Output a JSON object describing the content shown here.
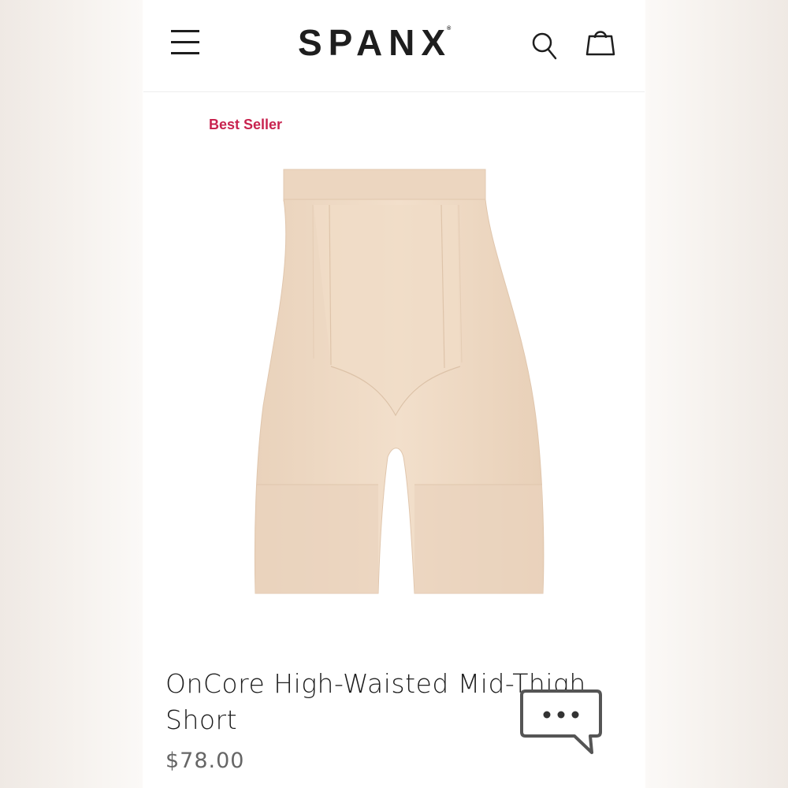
{
  "header": {
    "menu_icon": "hamburger-menu-icon",
    "logo": "SPANX",
    "logo_mark": "®",
    "search_icon": "search-icon",
    "bag_icon": "shopping-bag-icon"
  },
  "product": {
    "badge": "Best Seller",
    "title": "OnCore High-Waisted Mid-Thigh Short",
    "price": "$78.00",
    "image": "shapewear-shorts-nude"
  },
  "chat": {
    "icon": "chat-bubble-icon"
  },
  "colors": {
    "badge": "#c8234f",
    "text": "#1e1e1e",
    "price": "#666666",
    "product": "#efd9c3"
  }
}
